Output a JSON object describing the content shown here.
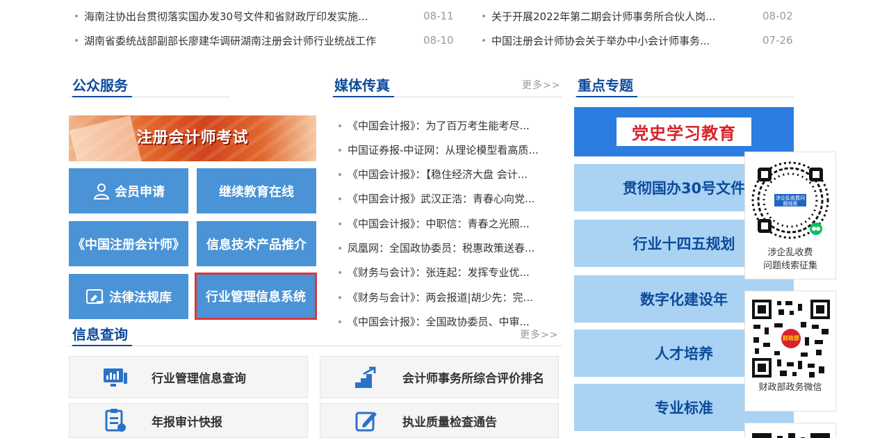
{
  "top_news": [
    {
      "title": "海南注协出台贯彻落实国办发30号文件和省财政厅印发实施...",
      "date": "08-11"
    },
    {
      "title": "关于开展2022年第二期会计师事务所合伙人岗...",
      "date": "08-02"
    },
    {
      "title": "湖南省委统战部副部长廖建华调研湖南注册会计师行业统战工作",
      "date": "08-10"
    },
    {
      "title": "中国注册会计师协会关于举办中小会计师事务...",
      "date": "07-26"
    }
  ],
  "public_service": {
    "title": "公众服务",
    "banner_text": "注册会计师考试",
    "tiles": [
      {
        "label": "会员申请",
        "icon": "user-icon"
      },
      {
        "label": "继续教育在线"
      },
      {
        "label": "《中国注册会计师》"
      },
      {
        "label": "信息技术产品推介"
      },
      {
        "label": "法律法规库",
        "icon": "law-book-icon"
      },
      {
        "label": "行业管理信息系统"
      }
    ]
  },
  "media": {
    "title": "媒体传真",
    "more": "更多>>",
    "items": [
      "《中国会计报》：为了百万考生能考尽...",
      "中国证券报-中证网：从理论模型看高质...",
      "《中国会计报》：【稳住经济大盘 会计...",
      "《中国会计报》武汉正浩：青春心向党...",
      "《中国会计报》：中职信：青春之光照...",
      "凤凰网：全国政协委员：税惠政策送春...",
      "《财务与会计》：张连起：发挥专业优...",
      "《财务与会计》：两会报道|胡少先：完...",
      "《中国会计报》：全国政协委员、中审..."
    ]
  },
  "info_query": {
    "title": "信息查询",
    "more": "更多>>",
    "cards": [
      {
        "label": "行业管理信息查询",
        "icon": "monitor-chart-icon"
      },
      {
        "label": "会计师事务所综合评价排名",
        "icon": "ranking-stairs-icon"
      },
      {
        "label": "年报审计快报",
        "icon": "report-clipboard-icon"
      },
      {
        "label": "执业质量检查通告",
        "icon": "edit-pen-icon"
      }
    ]
  },
  "key_topics": {
    "title": "重点专题",
    "main": "党史学习教育",
    "items": [
      "贯彻国办30号文件",
      "行业十四五规划",
      "数字化建设年",
      "人才培养",
      "专业标准"
    ]
  },
  "qr": {
    "mini_program_badge": "涉企乱收费问题线索",
    "mini_program_caption_1": "涉企乱收费",
    "mini_program_caption_2": "问题线索征集",
    "wechat_badge": "财政部",
    "wechat_caption": "财政部政务微信"
  },
  "colors": {
    "brand_blue": "#0c4a9a",
    "tile_blue": "#4a93d6",
    "topic_light_blue": "#a9d2f3",
    "topic_main_blue": "#2c7de0",
    "highlight_red": "#d9363e"
  }
}
